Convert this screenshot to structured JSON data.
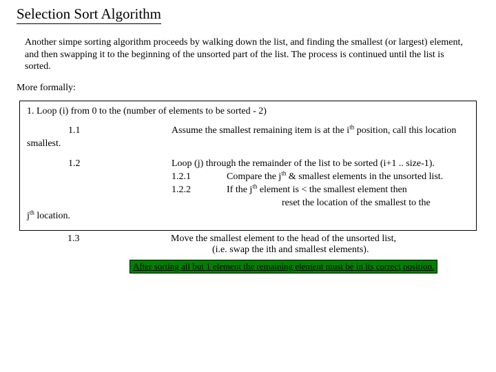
{
  "title": "Selection Sort Algorithm",
  "intro": "Another simpe sorting algorithm proceeds by walking down the list, and finding the smallest (or largest) element, and then swapping it to the beginning of the unsorted part of the list.  The process is continued until the list is sorted.",
  "formal": "More formally:",
  "step1": "1. Loop (i) from 0 to the (number of elements to be sorted - 2)",
  "s11_label": "1.1",
  "s11_text_a": "Assume the smallest remaining item is at the i",
  "s11_sup": "th",
  "s11_text_b": " position, call this location",
  "smallest_label": "smallest.",
  "s12_label": "1.2",
  "s12_text": "Loop (j) through the remainder of the list to be sorted (i+1 .. size-1).",
  "s121_num": "1.2.1",
  "s121_a": "Compare the j",
  "s121_sup": "th",
  "s121_b": " & smallest elements in the unsorted list.",
  "s122_num": "1.2.2",
  "s122_a": "If the j",
  "s122_sup": "th",
  "s122_b": " element is < the smallest element then",
  "s122_reset": "reset the location of the smallest to the",
  "jth_a": "j",
  "jth_sup": "th",
  "jth_b": " location.",
  "s13_label": "1.3",
  "s13_text": "Move the smallest element to the head of the unsorted list,",
  "s13_sub": "(i.e. swap the ith and smallest elements).",
  "highlight": "After sorting all but 1 element the remaining element must be in its correct position."
}
